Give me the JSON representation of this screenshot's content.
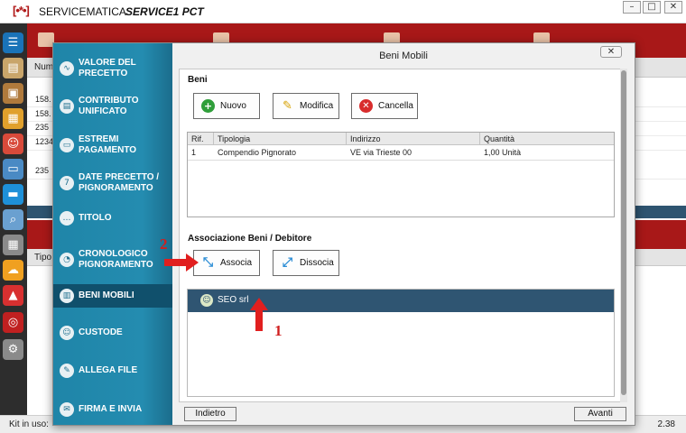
{
  "titlebar": {
    "logo": "[•*•]",
    "app_name": "SERVICEMATICA",
    "product": "SERVICE1 PCT",
    "min": "–",
    "max": "□",
    "close": "✕"
  },
  "rail": {
    "icons": [
      {
        "name": "menu-icon",
        "glyph": "☰",
        "color": "#1a73b8"
      },
      {
        "name": "notepad-icon",
        "glyph": "▤",
        "color": "#c9a56a"
      },
      {
        "name": "folder-icon",
        "glyph": "▣",
        "color": "#b07a3c"
      },
      {
        "name": "briefcase-icon",
        "glyph": "▦",
        "color": "#e0a02c"
      },
      {
        "name": "person-icon",
        "glyph": "☺",
        "color": "#d84a3a"
      },
      {
        "name": "computer-icon",
        "glyph": "▭",
        "color": "#4a8ac4"
      },
      {
        "name": "chat-icon",
        "glyph": "▬",
        "color": "#1e90d8"
      },
      {
        "name": "search-doc-icon",
        "glyph": "⌕",
        "color": "#6aa0d0"
      },
      {
        "name": "calculator-icon",
        "glyph": "▦",
        "color": "#8a8a8a"
      },
      {
        "name": "cloud-upload-icon",
        "glyph": "☁",
        "color": "#f0a020"
      },
      {
        "name": "calendar-alert-icon",
        "glyph": "▲",
        "color": "#d83030"
      },
      {
        "name": "lifebuoy-icon",
        "glyph": "◎",
        "color": "#c02020"
      },
      {
        "name": "gear-icon",
        "glyph": "⚙",
        "color": "#8a8a8a"
      }
    ]
  },
  "background": {
    "list_header": "Num",
    "rows": [
      "158.",
      "158.",
      "235",
      "1234",
      "",
      "235"
    ],
    "tipo_header": "Tipo"
  },
  "statusbar": {
    "kit_label": "Kit in uso:",
    "version": "2.38"
  },
  "dialog": {
    "title": "Beni Mobili",
    "close": "✕",
    "nav": [
      {
        "label": "VALORE DEL PRECETTO",
        "icon": "∿",
        "active": false
      },
      {
        "label": "CONTRIBUTO UNIFICATO",
        "icon": "▤",
        "active": false
      },
      {
        "label": "ESTREMI PAGAMENTO",
        "icon": "▭",
        "active": false
      },
      {
        "label": "DATE PRECETTO / PIGNORAMENTO",
        "icon": "7",
        "active": false
      },
      {
        "label": "TITOLO",
        "icon": "…",
        "active": false
      },
      {
        "label": "CRONOLOGICO PIGNORAMENTO",
        "icon": "◔",
        "active": false
      },
      {
        "label": "BENI MOBILI",
        "icon": "▥",
        "active": true
      },
      {
        "label": "CUSTODE",
        "icon": "☺",
        "active": false
      },
      {
        "label": "ALLEGA FILE",
        "icon": "✎",
        "active": false
      },
      {
        "label": "FIRMA E INVIA",
        "icon": "✉",
        "active": false
      }
    ],
    "beni": {
      "section_title": "Beni",
      "btn_nuovo": "Nuovo",
      "btn_modifica": "Modifica",
      "btn_cancella": "Cancella",
      "columns": [
        "Rif.",
        "Tipologia",
        "Indirizzo",
        "Quantità"
      ],
      "rows": [
        {
          "rif": "1",
          "tipologia": "Compendio Pignorato",
          "indirizzo": "VE via Trieste 00",
          "quantita": "1,00 Unità"
        }
      ]
    },
    "associazione": {
      "section_title": "Associazione Beni / Debitore",
      "btn_associa": "Associa",
      "btn_dissocia": "Dissocia",
      "debtor": "SEO srl"
    },
    "btn_indietro": "Indietro",
    "btn_avanti": "Avanti"
  },
  "annotations": {
    "step2": "2",
    "step1": "1"
  }
}
